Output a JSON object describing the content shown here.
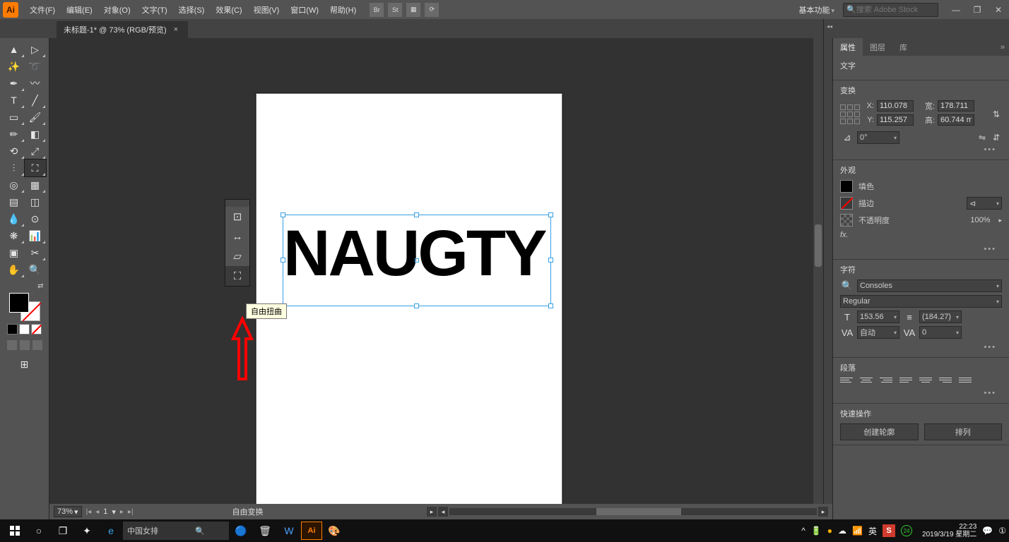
{
  "app": {
    "logo": "Ai"
  },
  "menu": {
    "file": "文件(F)",
    "edit": "编辑(E)",
    "object": "对象(O)",
    "type": "文字(T)",
    "select": "选择(S)",
    "effect": "效果(C)",
    "view": "视图(V)",
    "window": "窗口(W)",
    "help": "帮助(H)"
  },
  "header": {
    "workspace": "基本功能",
    "search_placeholder": "搜索 Adobe Stock",
    "br": "Br",
    "st": "St"
  },
  "doc": {
    "title": "未标题-1* @ 73% (RGB/预览)"
  },
  "canvas": {
    "text": "NAUGTY"
  },
  "floattool": {
    "tooltip": "自由扭曲"
  },
  "status": {
    "zoom": "73%",
    "page": "1",
    "mode": "自由变换"
  },
  "panel": {
    "tabs": {
      "properties": "属性",
      "layers": "图层",
      "libraries": "库"
    },
    "type_title": "文字",
    "transform": {
      "title": "变换",
      "x": "110.078",
      "y": "115.257",
      "w": "178.711",
      "h": "60.744 m",
      "angle": "0°",
      "xlabel": "X:",
      "ylabel": "Y:",
      "wlabel": "宽:",
      "hlabel": "高:"
    },
    "appearance": {
      "title": "外观",
      "fill": "填色",
      "stroke": "描边",
      "opacity": "不透明度",
      "opacity_val": "100%",
      "fx": "fx."
    },
    "character": {
      "title": "字符",
      "font": "Consoles",
      "style": "Regular",
      "size": "153.56",
      "leading": "(184.27)",
      "kerning": "自动",
      "tracking": "0"
    },
    "paragraph": {
      "title": "段落"
    },
    "quick": {
      "title": "快速操作",
      "outline": "创建轮廓",
      "arrange": "排列"
    }
  },
  "taskbar": {
    "search": "中国女排",
    "tray": {
      "ime": "英",
      "s": "S",
      "num": "24",
      "time": "22:23",
      "date": "2019/3/19 星期二"
    }
  }
}
